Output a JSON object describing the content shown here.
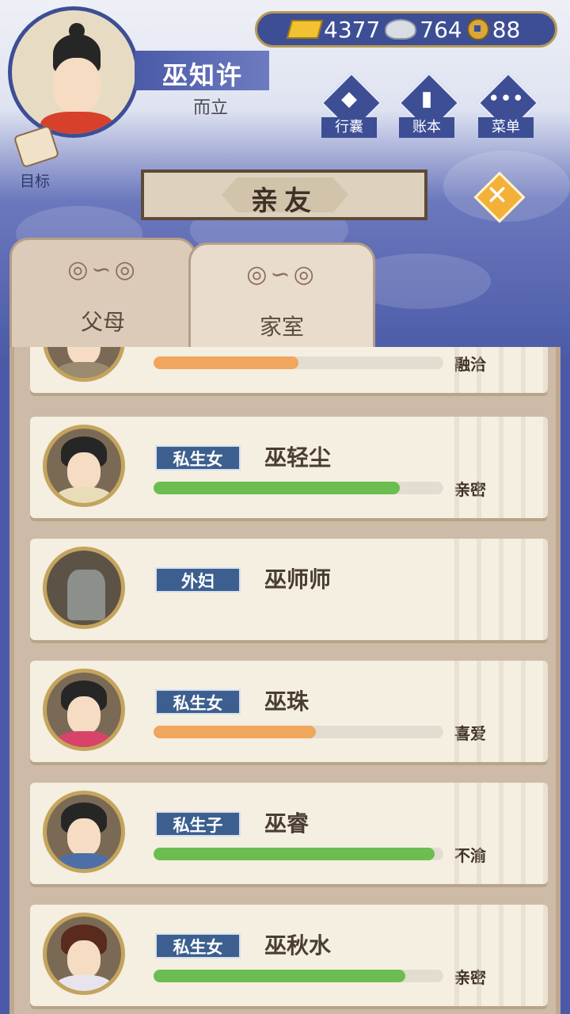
{
  "player": {
    "name": "巫知许",
    "age_title": "而立"
  },
  "currency": {
    "gold": "4377",
    "silver": "764",
    "coin": "88"
  },
  "menu": {
    "bag": "行囊",
    "ledger": "账本",
    "menu": "菜单",
    "goal": "目标"
  },
  "title": "亲友",
  "tabs": [
    {
      "label": "父母",
      "active": false
    },
    {
      "label": "家室",
      "active": true
    }
  ],
  "colors": {
    "green_bar": "#6cbd4f",
    "orange_bar": "#f0a65d",
    "tag_bg": "#3c5f8f"
  },
  "relatives": [
    {
      "relation": "",
      "name": "",
      "status": "融洽",
      "affinity_pct": 50,
      "bar_color": "#f0a65d"
    },
    {
      "relation": "私生女",
      "name": "巫轻尘",
      "status": "亲密",
      "affinity_pct": 85,
      "bar_color": "#6cbd4f"
    },
    {
      "relation": "外妇",
      "name": "巫师师",
      "status": "",
      "affinity_pct": null,
      "bar_color": ""
    },
    {
      "relation": "私生女",
      "name": "巫珠",
      "status": "喜爱",
      "affinity_pct": 56,
      "bar_color": "#f0a65d"
    },
    {
      "relation": "私生子",
      "name": "巫睿",
      "status": "不渝",
      "affinity_pct": 97,
      "bar_color": "#6cbd4f"
    },
    {
      "relation": "私生女",
      "name": "巫秋水",
      "status": "亲密",
      "affinity_pct": 87,
      "bar_color": "#6cbd4f"
    }
  ]
}
